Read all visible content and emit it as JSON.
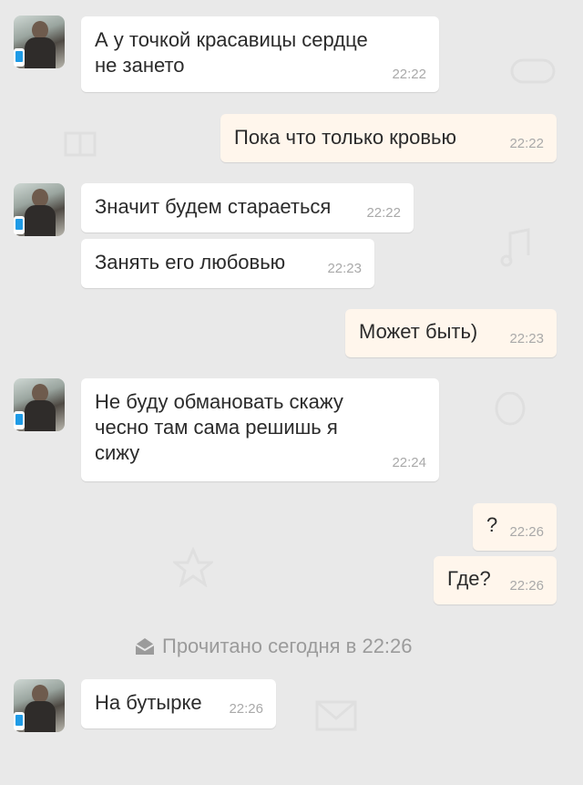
{
  "messages": [
    {
      "direction": "in",
      "text": "А у точкой красавицы сердце\nне зането",
      "time": "22:22",
      "avatar": true
    },
    {
      "direction": "out",
      "text": "Пока что только кровью",
      "time": "22:22"
    },
    {
      "direction": "in",
      "text": "Значит будем стараеться",
      "time": "22:22",
      "avatar": true
    },
    {
      "direction": "in",
      "text": "Занять его любовью",
      "time": "22:23"
    },
    {
      "direction": "out",
      "text": "Может быть)",
      "time": "22:23"
    },
    {
      "direction": "in",
      "text": "Не буду обмановать скажу\nчесно там сама решишь я\nсижу",
      "time": "22:24",
      "avatar": true
    },
    {
      "direction": "out",
      "text": "?",
      "time": "22:26"
    },
    {
      "direction": "out",
      "text": "Где?",
      "time": "22:26"
    },
    {
      "direction": "in",
      "text": "На бутырке",
      "time": "22:26",
      "avatar": true
    }
  ],
  "read_receipt": {
    "text": "Прочитано сегодня в 22:26",
    "icon": "envelope-open-icon"
  },
  "colors": {
    "background": "#e9e9e9",
    "incoming_bubble": "#ffffff",
    "outgoing_bubble": "#fff6ec",
    "text": "#2b2b2b",
    "time": "#a9a9a9",
    "badge": "#1f9be6"
  }
}
